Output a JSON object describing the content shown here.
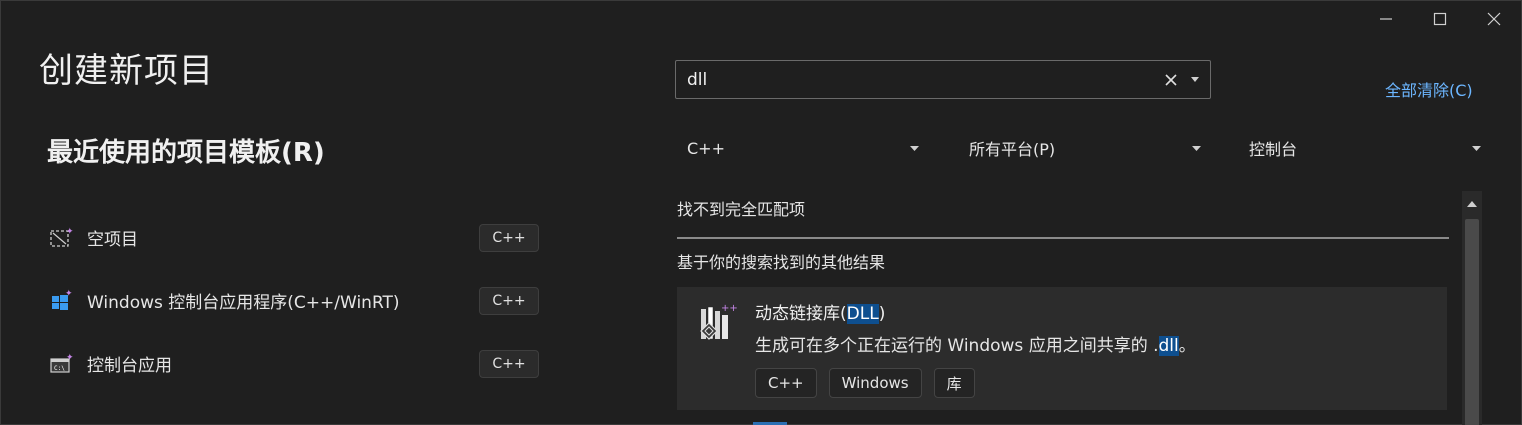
{
  "window": {
    "title": "创建新项目",
    "minimize": "minimize",
    "maximize": "maximize",
    "close": "close"
  },
  "recent": {
    "title": "最近使用的项目模板(R)",
    "items": [
      {
        "label": "空项目",
        "tag": "C++",
        "icon": "empty-project-icon"
      },
      {
        "label": "Windows 控制台应用程序(C++/WinRT)",
        "tag": "C++",
        "icon": "windows-logo-icon"
      },
      {
        "label": "控制台应用",
        "tag": "C++",
        "icon": "console-app-icon"
      }
    ]
  },
  "search": {
    "value": "dll",
    "clear_all": "全部清除(C)"
  },
  "filters": {
    "language": "C++",
    "platform": "所有平台(P)",
    "project_type": "控制台"
  },
  "results": {
    "no_match": "找不到完全匹配项",
    "other_results": "基于你的搜索找到的其他结果",
    "items": [
      {
        "title_prefix": "动态链接库(",
        "title_highlight": "DLL",
        "title_suffix": ")",
        "desc_prefix": "生成可在多个正在运行的 Windows 应用之间共享的 .",
        "desc_highlight": "dll",
        "desc_suffix": "。",
        "tags": [
          "C++",
          "Windows",
          "库"
        ],
        "icon": "dll-library-icon"
      }
    ]
  },
  "colors": {
    "background": "#1f1f1f",
    "card": "#2c2c2c",
    "accent_link": "#6cb6ff",
    "highlight": "#0e4f8f",
    "icon_purple": "#c586e8"
  }
}
